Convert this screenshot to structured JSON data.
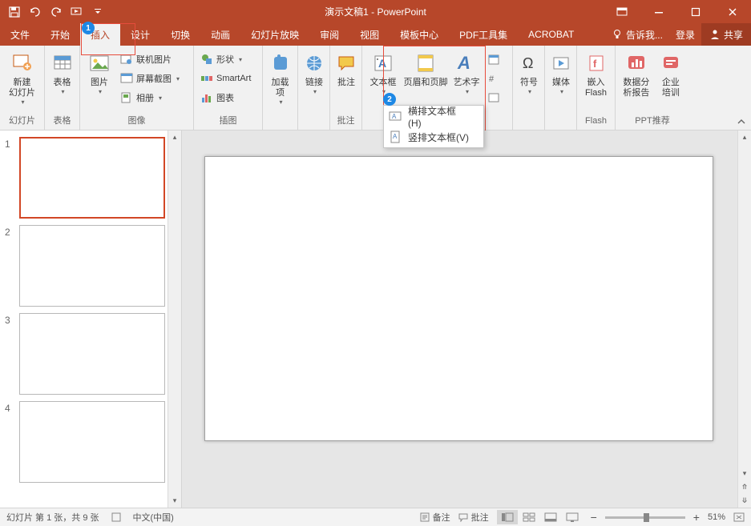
{
  "title": "演示文稿1 - PowerPoint",
  "tabs": {
    "file": "文件",
    "home": "开始",
    "insert": "插入",
    "design": "设计",
    "transitions": "切换",
    "animations": "动画",
    "slideshow": "幻灯片放映",
    "review": "审阅",
    "view": "视图",
    "template": "模板中心",
    "pdf": "PDF工具集",
    "acrobat": "ACROBAT"
  },
  "tellme": "告诉我...",
  "login": "登录",
  "share": "共享",
  "ribbon": {
    "slides": {
      "new_slide": "新建\n幻灯片",
      "group": "幻灯片"
    },
    "tables": {
      "table": "表格",
      "group": "表格"
    },
    "images": {
      "pictures": "图片",
      "online": "联机图片",
      "screenshot": "屏幕截图",
      "album": "相册",
      "group": "图像"
    },
    "illustrations": {
      "shapes": "形状",
      "smartart": "SmartArt",
      "chart": "图表",
      "group": "插图"
    },
    "addins": {
      "addins": "加载\n项",
      "group": ""
    },
    "links": {
      "links": "链接",
      "group": ""
    },
    "comments": {
      "comment": "批注",
      "group": "批注"
    },
    "text": {
      "textbox": "文本框",
      "header": "页眉和页脚",
      "wordart": "艺术字",
      "group": ""
    },
    "symbols": {
      "symbol": "符号",
      "group": ""
    },
    "media": {
      "media": "媒体",
      "group": ""
    },
    "flash": {
      "embed": "嵌入\nFlash",
      "group": "Flash"
    },
    "ppt": {
      "analysis": "数据分\n析报告",
      "training": "企业\n培训",
      "group": "PPT推荐"
    }
  },
  "dropdown": {
    "horizontal": "横排文本框(H)",
    "vertical": "竖排文本框(V)"
  },
  "bubbles": {
    "b1": "1",
    "b2": "2"
  },
  "slides": {
    "s1": "1",
    "s2": "2",
    "s3": "3",
    "s4": "4"
  },
  "status": {
    "slide_info": "幻灯片 第 1 张，共 9 张",
    "lang": "中文(中国)",
    "notes": "备注",
    "comments": "批注",
    "zoom": "51%"
  }
}
